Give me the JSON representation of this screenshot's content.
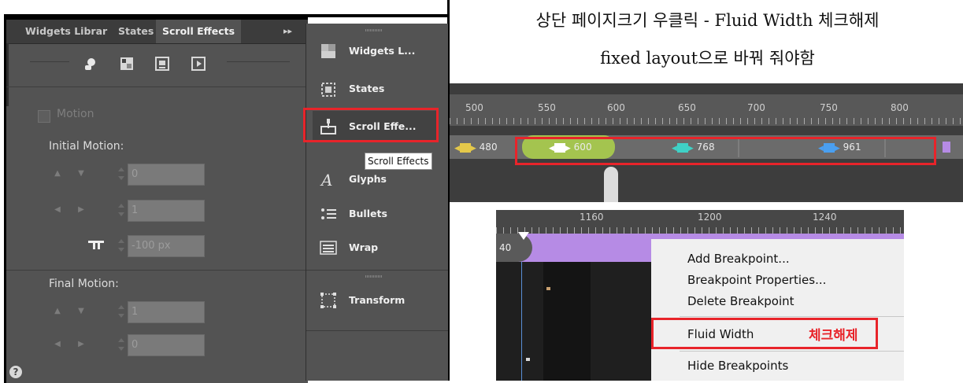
{
  "left_panel": {
    "tabs": [
      {
        "label": "Widgets Librar"
      },
      {
        "label": "States"
      },
      {
        "label": "Scroll Effects"
      }
    ],
    "collapse_glyph": "▸▸",
    "icons": [
      "scroll-effect-hand-icon",
      "scroll-effect-image-icon",
      "scroll-effect-slideshow-icon",
      "scroll-effect-video-icon"
    ],
    "motion_label": "Motion",
    "initial_motion_label": "Initial Motion:",
    "initial_vertical_value": "0",
    "initial_horizontal_value": "1",
    "offset_value": "-100 px",
    "final_motion_label": "Final Motion:",
    "final_vertical_value": "1",
    "final_horizontal_value": "0",
    "help_glyph": "?"
  },
  "mid_panel": {
    "items": [
      {
        "label": "Widgets L...",
        "icon": "widgets-icon"
      },
      {
        "label": "States",
        "icon": "states-icon"
      },
      {
        "label": "Scroll Effe...",
        "icon": "scroll-effects-icon"
      },
      {
        "label": "Glyphs",
        "icon": "glyphs-icon"
      },
      {
        "label": "Bullets",
        "icon": "bullets-icon"
      },
      {
        "label": "Wrap",
        "icon": "wrap-icon"
      },
      {
        "label": "Transform",
        "icon": "transform-icon"
      }
    ],
    "tooltip": "Scroll Effects",
    "highlight_color": "#e8242a"
  },
  "note": {
    "line1": "상단 페이지크기 우클릭 - Fluid Width 체크해제",
    "line2": "fixed layout으로 바꿔 줘야함"
  },
  "ruler_top": {
    "ticks": [
      "500",
      "550",
      "600",
      "650",
      "700",
      "750",
      "800"
    ],
    "breakpoints": [
      {
        "value": "480",
        "color": "#e4c84a"
      },
      {
        "value": "600",
        "color": "#ffffff"
      },
      {
        "value": "768",
        "color": "#3fd1c6"
      },
      {
        "value": "961",
        "color": "#4a9ff0"
      }
    ]
  },
  "ruler_bottom": {
    "ticks": [
      "1160",
      "1200",
      "1240"
    ],
    "bar_label": "40",
    "bar_color": "#b68be5"
  },
  "context_menu": {
    "items": [
      {
        "label": "Add Breakpoint..."
      },
      {
        "label": "Breakpoint Properties..."
      },
      {
        "label": "Delete Breakpoint"
      },
      {
        "label": "Fluid Width"
      },
      {
        "label": "Hide Breakpoints"
      }
    ],
    "annotation": "체크해제",
    "annotation_color": "#e8242a"
  }
}
